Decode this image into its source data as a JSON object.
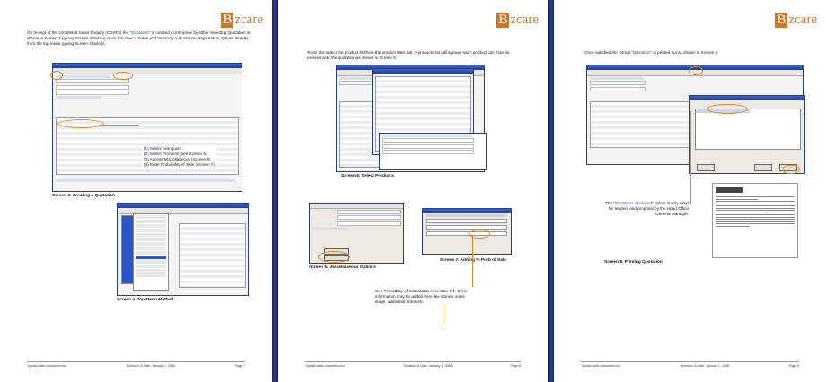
{
  "brand": {
    "logo_letter": "B",
    "logo_rest": "zcare"
  },
  "page1": {
    "intro_a": "On receipt of the completed Sales Enquiry (CDSF5) the \"",
    "intro_quote": "Quotation",
    "intro_b": "\" is created in Interprise by either selecting Quotation as shown in Screen 1 (giving Screen 3 below) or via the View > Sales and Invoicing > Quotation Registration options directly from the top menu (giving Screen 4 below).",
    "steps": [
      "(1) Select new quote",
      "(2) Select Products (see Screen 5)",
      "(3) Access Miscellaneous (Screen 6)",
      "(4) Enter Probability of Sale (Screen 7)"
    ],
    "caption_a": "Screen 3. Creating a Quotation",
    "caption_b": "Screen 4. Top Menu Method",
    "footer": {
      "left": "Typical sales document.doc",
      "mid": "Revision: A  Date: January 1, 2008",
      "right": "Page 7"
    }
  },
  "page2": {
    "intro": "To do this select the product list from the product lines tab. A products list will appear, each product can than be entered onto the quotation as shown in Screen 5.",
    "caption_a": "Screen 5. Select Products",
    "caption_b": "Screen 6. Miscellaneous Options",
    "caption_c": "Screen 7. Adding % Prob of Sale",
    "note": "See Probability of Sale Matrix in section 7.4. Other information may be added here like stones, sales stage, additional notes etc.",
    "footer": {
      "left": "Typical sales document.doc",
      "mid": "Revision: A  Date: January 1, 2008",
      "right": "Page 8"
    }
  },
  "page3": {
    "intro_a": "Once satisfied the formal \"",
    "intro_quote": "Quotation",
    "intro_b": "\" is printed out as shown in Screen 8.",
    "note_a": "The \"",
    "note_quote": "Quotation advanced",
    "note_b": "\" option is only used for tenders and proposal by the Head Office General Manager.",
    "caption": "Screen 8. Printing Quotation",
    "footer": {
      "left": "Typical sales document.doc",
      "mid": "Revision: A  Date: January 1, 2008",
      "right": "Page 9"
    }
  },
  "colors": {
    "accent": "#e0891f",
    "link": "#1b3fb5",
    "background": "#2a3a8c"
  }
}
